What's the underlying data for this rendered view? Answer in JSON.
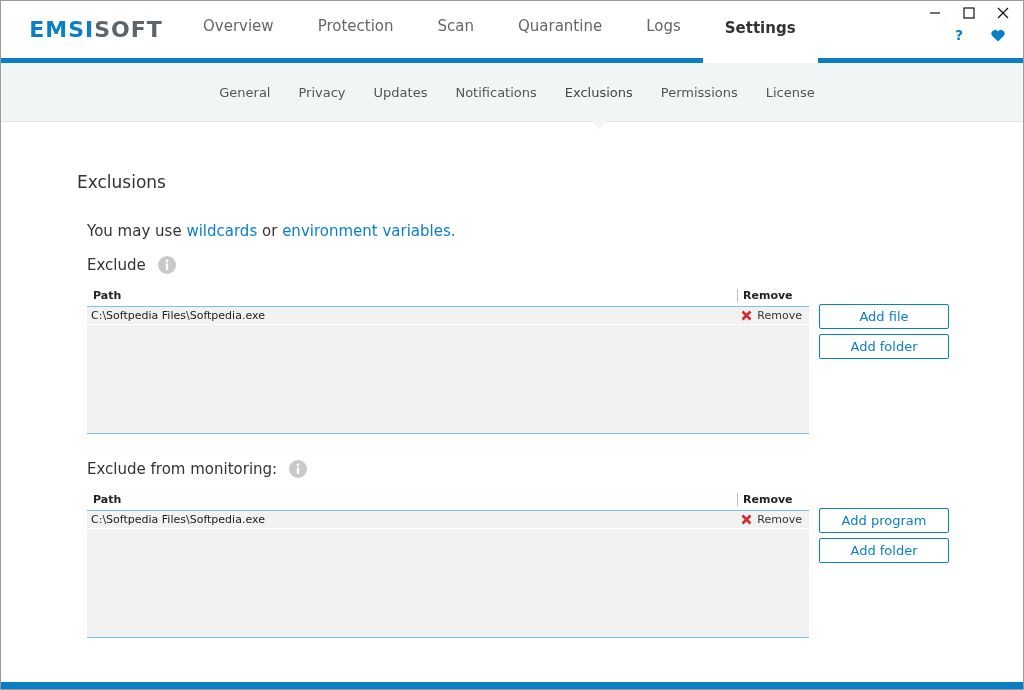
{
  "logo": [
    "EMSI",
    "SOFT"
  ],
  "tabs": [
    {
      "label": "Overview",
      "selected": false
    },
    {
      "label": "Protection",
      "selected": false
    },
    {
      "label": "Scan",
      "selected": false
    },
    {
      "label": "Quarantine",
      "selected": false
    },
    {
      "label": "Logs",
      "selected": false
    },
    {
      "label": "Settings",
      "selected": true
    }
  ],
  "help_label": "?",
  "subtabs": [
    {
      "label": "General",
      "selected": false
    },
    {
      "label": "Privacy",
      "selected": false
    },
    {
      "label": "Updates",
      "selected": false
    },
    {
      "label": "Notifications",
      "selected": false
    },
    {
      "label": "Exclusions",
      "selected": true
    },
    {
      "label": "Permissions",
      "selected": false
    },
    {
      "label": "License",
      "selected": false
    }
  ],
  "page_title": "Exclusions",
  "hint": {
    "before": "You may use",
    "link_1": "wildcards",
    "middle": "or",
    "link_2": "environment variables."
  },
  "sections": [
    {
      "label": "Exclude",
      "columns": [
        "Path",
        "Remove"
      ],
      "rows": [
        {
          "path": "C:\\Softpedia Files\\Softpedia.exe",
          "action": "Remove"
        }
      ],
      "buttons": [
        "Add file",
        "Add folder"
      ]
    },
    {
      "label": "Exclude from monitoring:",
      "columns": [
        "Path",
        "Remove"
      ],
      "rows": [
        {
          "path": "C:\\Softpedia Files\\Softpedia.exe",
          "action": "Remove"
        }
      ],
      "buttons": [
        "Add program",
        "Add folder"
      ]
    }
  ]
}
